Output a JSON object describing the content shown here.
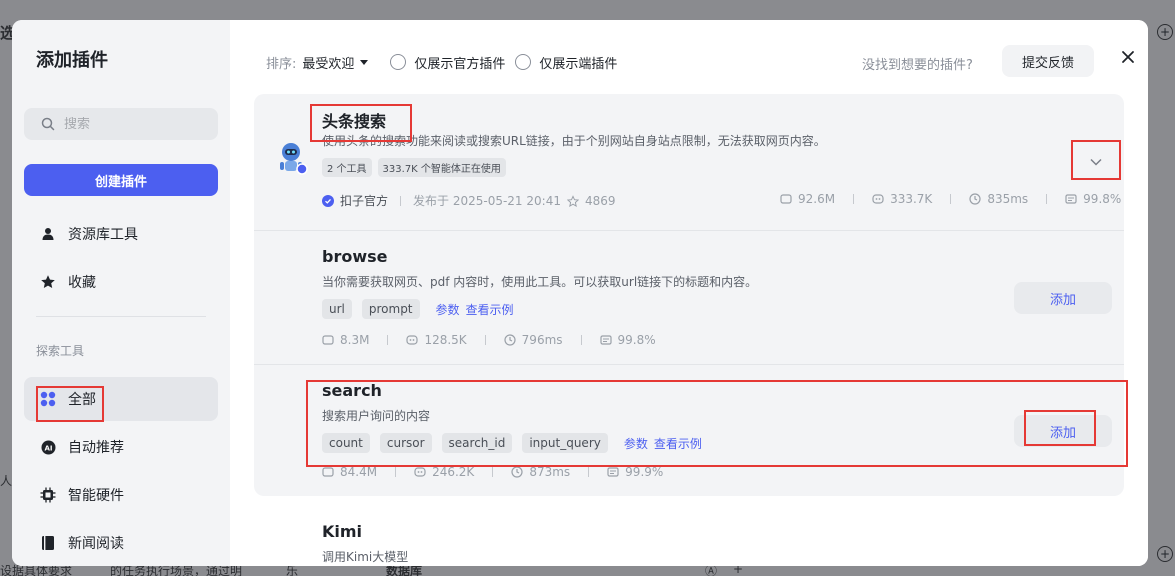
{
  "background": {
    "frag_left_top": "选",
    "frag_left_mid": "人",
    "frag_bottom_1": "设据具体要求",
    "frag_bottom_2": "的任务执行场景，通过明",
    "frag_bottom_3": "乐",
    "frag_bottom_4": "数据库",
    "frag_bottom_5": "Ⓐ",
    "frag_bottom_6": "+"
  },
  "modal": {
    "title": "添加插件",
    "search_placeholder": "搜索",
    "create_button": "创建插件",
    "nav_top": [
      {
        "label": "资源库工具",
        "icon": "person-icon"
      },
      {
        "label": "收藏",
        "icon": "star-icon"
      }
    ],
    "section_label": "探索工具",
    "nav_explore": [
      {
        "label": "全部",
        "icon": "grid-icon",
        "active": true
      },
      {
        "label": "自动推荐",
        "icon": "ai-icon"
      },
      {
        "label": "智能硬件",
        "icon": "chip-icon"
      },
      {
        "label": "新闻阅读",
        "icon": "book-icon"
      }
    ]
  },
  "filters": {
    "sort_label": "排序:",
    "sort_value": "最受欢迎",
    "radio_official": "仅展示官方插件",
    "radio_device": "仅展示端插件",
    "no_find": "没找到想要的插件?",
    "feedback": "提交反馈"
  },
  "plugins": [
    {
      "name": "头条搜索",
      "desc": "使用头条的搜索功能来阅读或搜索URL链接，由于个别网站自身站点限制，无法获取网页内容。",
      "badges": [
        "2 个工具",
        "333.7K 个智能体正在使用"
      ],
      "publisher": "扣子官方",
      "published": "发布于 2025-05-21 20:41",
      "stars": "4869",
      "stats": [
        "92.6M",
        "333.7K",
        "835ms",
        "99.8%"
      ]
    },
    {
      "name": "browse",
      "desc": "当你需要获取网页、pdf 内容时，使用此工具。可以获取url链接下的标题和内容。",
      "params": [
        "url",
        "prompt"
      ],
      "param_link": "参数",
      "example_link": "查看示例",
      "stats": [
        "8.3M",
        "128.5K",
        "796ms",
        "99.8%"
      ],
      "add": "添加"
    },
    {
      "name": "search",
      "desc": "搜索用户询问的内容",
      "params": [
        "count",
        "cursor",
        "search_id",
        "input_query"
      ],
      "param_link": "参数",
      "example_link": "查看示例",
      "stats": [
        "84.4M",
        "246.2K",
        "873ms",
        "99.9%"
      ],
      "add": "添加"
    },
    {
      "name": "Kimi",
      "desc": "调用Kimi大模型"
    }
  ],
  "colors": {
    "accent": "#4c5ff0",
    "highlight": "#e53935"
  }
}
